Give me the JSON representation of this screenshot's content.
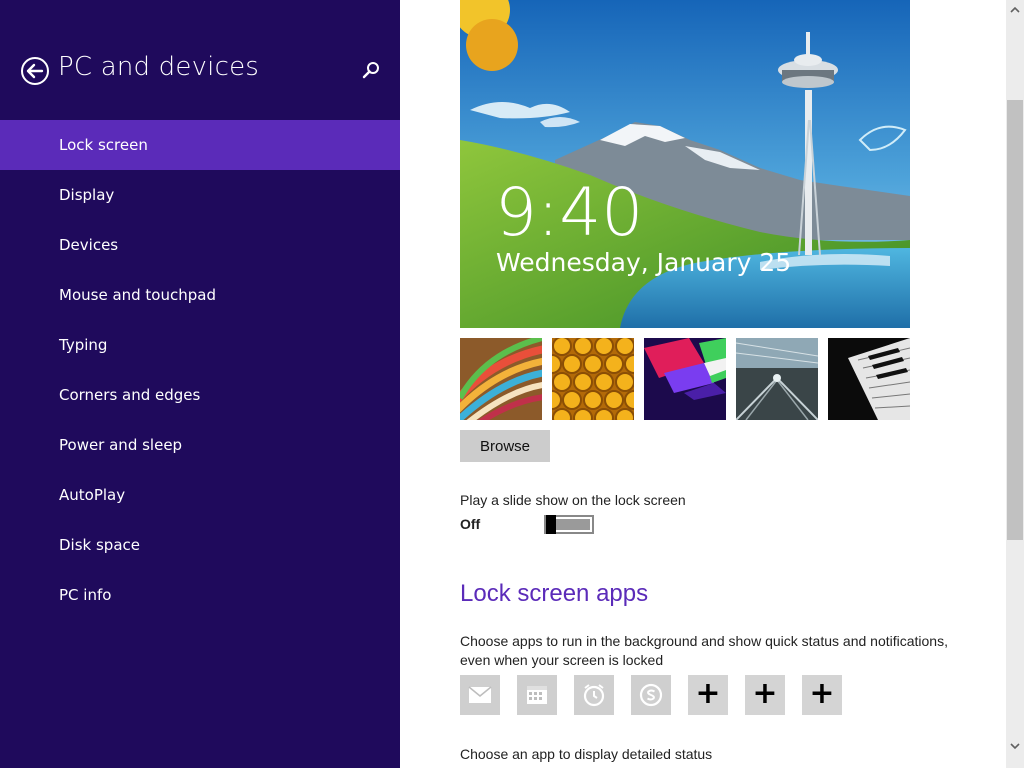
{
  "sidebar": {
    "title": "PC and devices",
    "items": [
      {
        "label": "Lock screen"
      },
      {
        "label": "Display"
      },
      {
        "label": "Devices"
      },
      {
        "label": "Mouse and touchpad"
      },
      {
        "label": "Typing"
      },
      {
        "label": "Corners and edges"
      },
      {
        "label": "Power and sleep"
      },
      {
        "label": "AutoPlay"
      },
      {
        "label": "Disk space"
      },
      {
        "label": "PC info"
      }
    ],
    "selected": "Lock screen"
  },
  "icons": {
    "back": "back-arrow-icon",
    "search": "search-icon",
    "mail": "mail-icon",
    "calendar": "calendar-icon",
    "alarms": "alarm-clock-icon",
    "skype": "skype-icon",
    "add": "plus-icon"
  },
  "lock_preview": {
    "time": "9:40",
    "date": "Wednesday, January 25"
  },
  "browse_label": "Browse",
  "slideshow": {
    "label": "Play a slide show on the lock screen",
    "state": "Off"
  },
  "lock_screen_apps": {
    "heading": "Lock screen apps",
    "description": "Choose apps to run in the background and show quick status and notifications, even when your screen is locked",
    "add_symbol": "+",
    "detail_label": "Choose an app to display detailed status"
  },
  "colors": {
    "sidebar_bg": "#1f0a5c",
    "selected_bg": "#5b2bb9",
    "accent": "#5b2bb9",
    "content_bg": "#ffffff"
  }
}
